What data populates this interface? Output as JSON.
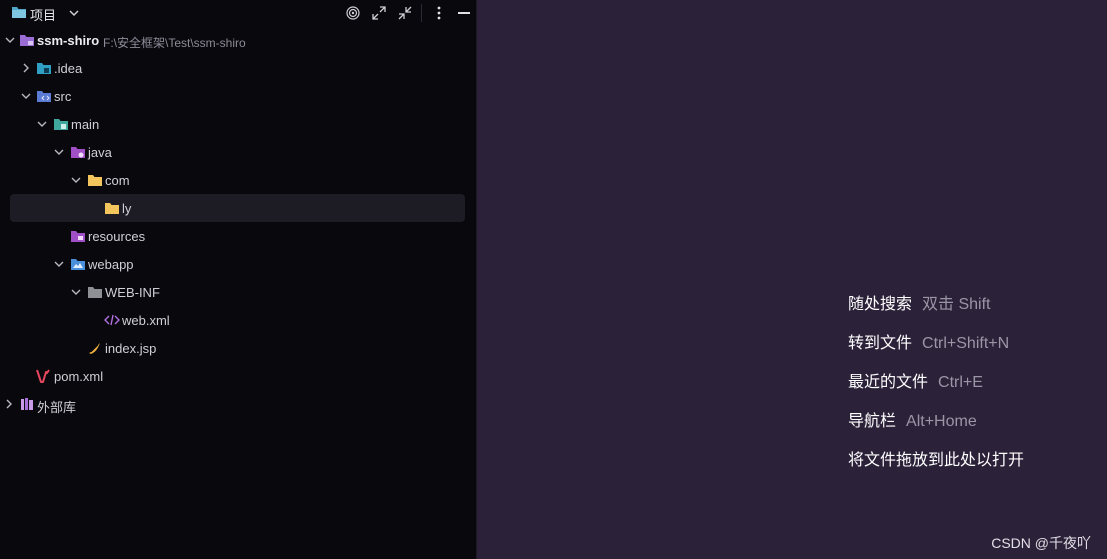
{
  "panel": {
    "title": "项目"
  },
  "tree": {
    "root_name": "ssm-shiro",
    "root_path": "F:\\安全框架\\Test\\ssm-shiro",
    "idea": ".idea",
    "src": "src",
    "main": "main",
    "java": "java",
    "com": "com",
    "ly": "ly",
    "resources": "resources",
    "webapp": "webapp",
    "web_inf": "WEB-INF",
    "web_xml": "web.xml",
    "index_jsp": "index.jsp",
    "pom_xml": "pom.xml",
    "external_libs": "外部库"
  },
  "hints": [
    {
      "label": "随处搜索",
      "shortcut": "双击 Shift"
    },
    {
      "label": "转到文件",
      "shortcut": "Ctrl+Shift+N"
    },
    {
      "label": "最近的文件",
      "shortcut": "Ctrl+E"
    },
    {
      "label": "导航栏",
      "shortcut": "Alt+Home"
    },
    {
      "label": "将文件拖放到此处以打开",
      "shortcut": ""
    }
  ],
  "watermark": "CSDN @千夜吖",
  "colors": {
    "panel_bg": "#09080d",
    "editor_bg": "#2b2139",
    "selection_bg": "#1d1b24"
  }
}
